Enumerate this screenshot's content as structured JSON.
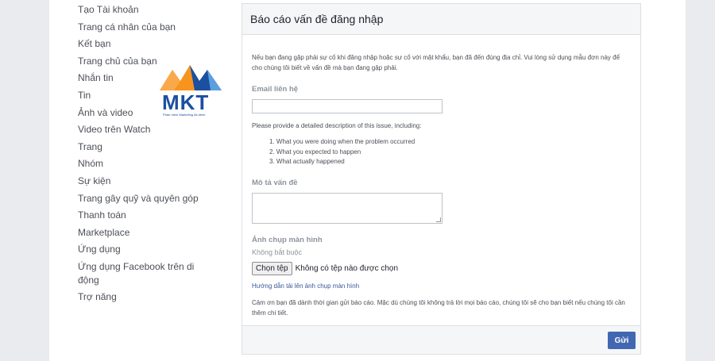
{
  "sidebar": {
    "items": [
      "Tạo Tài khoản",
      "Trang cá nhân của bạn",
      "Kết bạn",
      "Trang chủ của bạn",
      "Nhắn tin",
      "Tin",
      "Ảnh và video",
      "Video trên Watch",
      "Trang",
      "Nhóm",
      "Sự kiện",
      "Trang gây quỹ và quyên góp",
      "Thanh toán",
      "Marketplace",
      "Ứng dụng",
      "Ứng dụng Facebook trên di động",
      "Trợ năng"
    ]
  },
  "logo": {
    "text": "MKT",
    "subtitle": "Phần mềm Marketing đa kênh",
    "colors": {
      "orange": "#f7941d",
      "blue": "#1b4fa0",
      "light_blue": "#5aa0e0"
    }
  },
  "form": {
    "title": "Báo cáo vấn đề đăng nhập",
    "intro": "Nếu bạn đang gặp phải sự cố khi đăng nhập hoặc sự cố với mật khẩu, bạn đã đến đúng địa chỉ. Vui lòng sử dụng mẫu đơn này để cho chúng tôi biết về vấn đề mà bạn đang gặp phải.",
    "email_label": "Email liên hệ",
    "email_value": "",
    "description_prompt": "Please provide a detailed description of this issue, including:",
    "steps": [
      "1. What you were doing when the problem occurred",
      "2. What you expected to happen",
      "3. What actually happened"
    ],
    "description_label": "Mô tả vấn đề",
    "description_value": "",
    "screenshot_label": "Ảnh chụp màn hình",
    "optional_label": "Không bắt buộc",
    "file_button": "Chọn tệp",
    "file_status": "Không có tệp nào được chọn",
    "help_link": "Hướng dẫn tải lên ảnh chụp màn hình",
    "thanks": "Cảm ơn bạn đã dành thời gian gửi báo cáo. Mặc dù chúng tôi không trả lời mọi báo cáo, chúng tôi sẽ cho bạn biết nếu chúng tôi cần thêm chi tiết.",
    "submit_label": "Gửi"
  },
  "colors": {
    "page_bg": "#e9ebee",
    "accent": "#4267b2",
    "link": "#365899"
  }
}
